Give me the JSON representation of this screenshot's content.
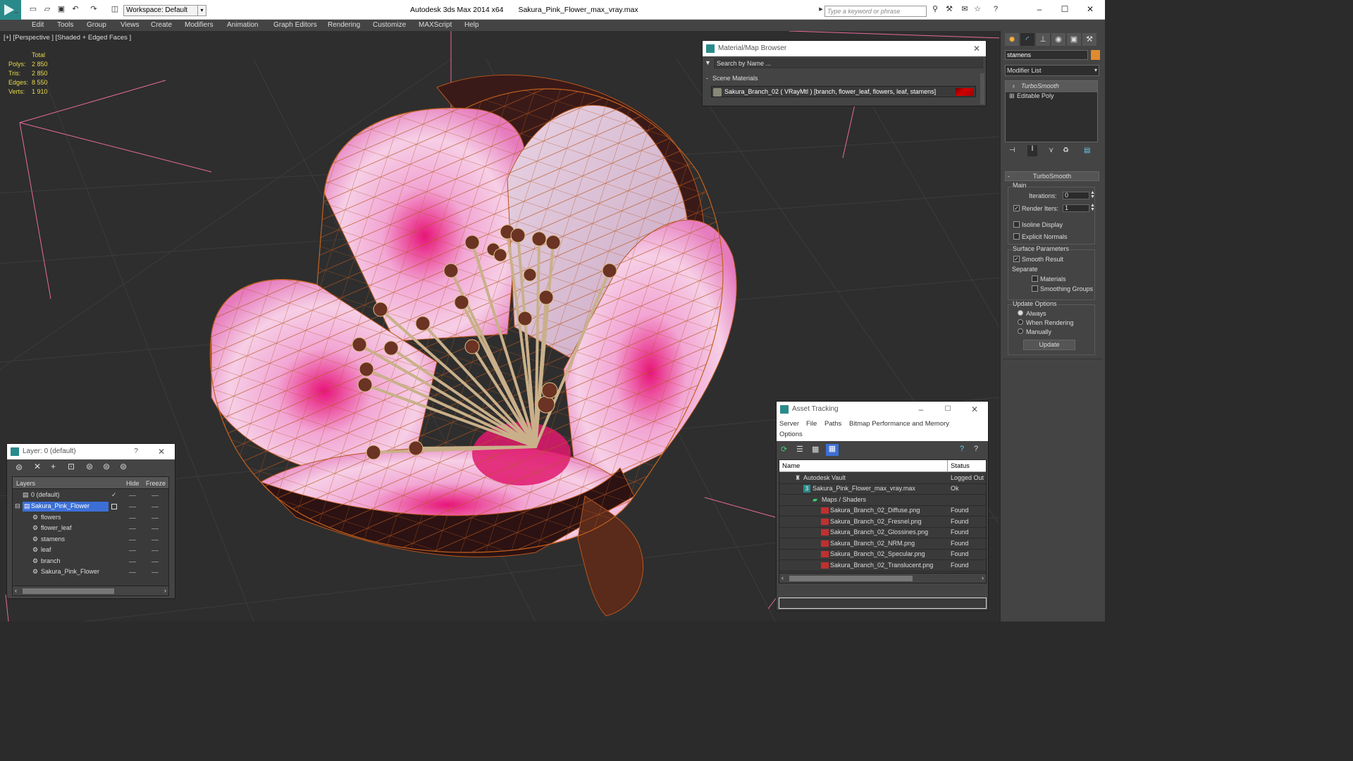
{
  "titlebar": {
    "workspace_label": "Workspace: Default",
    "app_title": "Autodesk 3ds Max  2014 x64",
    "file_title": "Sakura_Pink_Flower_max_vray.max",
    "search_placeholder": "Type a keyword or phrase"
  },
  "menu": {
    "items": [
      "Edit",
      "Tools",
      "Group",
      "Views",
      "Create",
      "Modifiers",
      "Animation",
      "Graph Editors",
      "Rendering",
      "Customize",
      "MAXScript",
      "Help"
    ]
  },
  "viewport": {
    "label": "[+] [Perspective ] [Shaded + Edged Faces ]",
    "stats": {
      "header": "Total",
      "polys_label": "Polys:",
      "polys_value": "2 850",
      "tris_label": "Tris:",
      "tris_value": "2 850",
      "edges_label": "Edges:",
      "edges_value": "8 550",
      "verts_label": "Verts:",
      "verts_value": "1 910"
    }
  },
  "material_browser": {
    "title": "Material/Map Browser",
    "search_placeholder": "Search by Name ...",
    "section": "Scene Materials",
    "material": "Sakura_Branch_02  ( VRayMtl )  [branch, flower_leaf, flowers, leaf, stamens]"
  },
  "command_panel": {
    "object_name": "stamens",
    "modifier_list": "Modifier List",
    "stack": [
      "TurboSmooth",
      "Editable Poly"
    ],
    "rollout_title": "TurboSmooth",
    "main_label": "Main",
    "iterations_label": "Iterations:",
    "iterations_value": "0",
    "render_iters_label": "Render Iters:",
    "render_iters_value": "1",
    "isoline": "Isoline Display",
    "explicit_normals": "Explicit Normals",
    "surface_params": "Surface Parameters",
    "smooth_result": "Smooth Result",
    "separate": "Separate",
    "materials": "Materials",
    "smoothing_groups": "Smoothing Groups",
    "update_options": "Update Options",
    "always": "Always",
    "when_rendering": "When Rendering",
    "manually": "Manually",
    "update_button": "Update"
  },
  "layer_window": {
    "title": "Layer: 0 (default)",
    "help": "?",
    "col_layers": "Layers",
    "col_hide": "Hide",
    "col_freeze": "Freeze",
    "rows": [
      "0 (default)",
      "Sakura_Pink_Flower",
      "flowers",
      "flower_leaf",
      "stamens",
      "leaf",
      "branch",
      "Sakura_Pink_Flower"
    ]
  },
  "asset_tracking": {
    "title": "Asset Tracking",
    "menu": [
      "Server",
      "File",
      "Paths",
      "Bitmap Performance and Memory",
      "Options"
    ],
    "col_name": "Name",
    "col_status": "Status",
    "rows": [
      {
        "name": "Autodesk Vault",
        "status": "Logged Out"
      },
      {
        "name": "Sakura_Pink_Flower_max_vray.max",
        "status": "Ok"
      },
      {
        "name": "Maps / Shaders",
        "status": ""
      },
      {
        "name": "Sakura_Branch_02_Diffuse.png",
        "status": "Found"
      },
      {
        "name": "Sakura_Branch_02_Fresnel.png",
        "status": "Found"
      },
      {
        "name": "Sakura_Branch_02_Glossines.png",
        "status": "Found"
      },
      {
        "name": "Sakura_Branch_02_NRM.png",
        "status": "Found"
      },
      {
        "name": "Sakura_Branch_02_Specular.png",
        "status": "Found"
      },
      {
        "name": "Sakura_Branch_02_Translucent.png",
        "status": "Found"
      }
    ]
  },
  "colors": {
    "accent": "#2a8a8a",
    "stats_yellow": "#e7d94a",
    "selection_blue": "#3c6fd6",
    "petal_pink": "#e87cc0",
    "wire_orange": "#b8561e"
  }
}
